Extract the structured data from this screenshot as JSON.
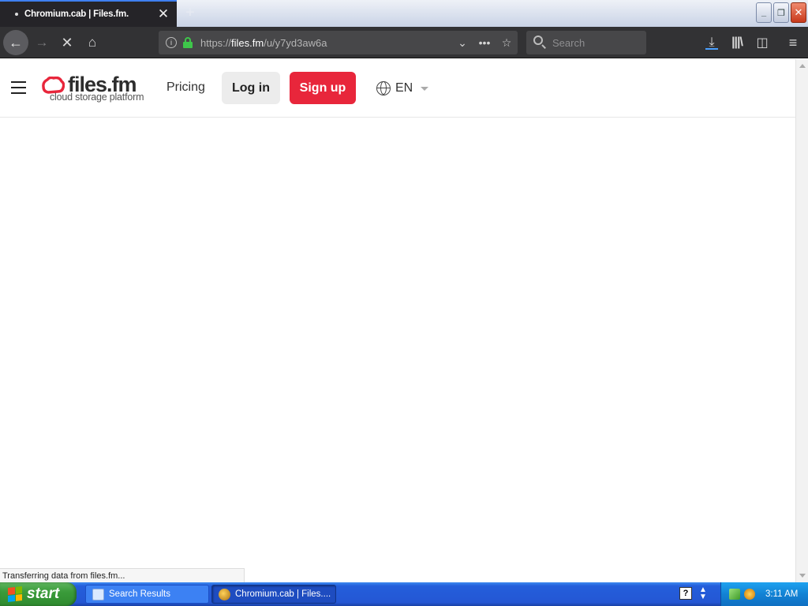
{
  "browser": {
    "tab": {
      "title": "Chromium.cab | Files.fm.",
      "close": "✕"
    },
    "new_tab": "+",
    "window_controls": {
      "minimize": "_",
      "restore": "❐",
      "close": "✕"
    },
    "nav": {
      "back": "←",
      "forward": "→",
      "stop": "✕",
      "home": "⌂"
    },
    "url": {
      "scheme": "https://",
      "host": "files.fm",
      "path": "/u/y7yd3aw6a"
    },
    "url_buttons": {
      "dropdown": "⌄",
      "page_actions": "•••",
      "bookmark": "☆"
    },
    "search": {
      "placeholder": "Search"
    },
    "toolbar": {
      "download": "⤓",
      "library": "|||\\",
      "sidebar": "◫",
      "menu": "≡"
    },
    "status_text": "Transferring data from files.fm..."
  },
  "site": {
    "logo": {
      "name": "files.fm",
      "tagline": "cloud storage platform",
      "color": "#e8263b"
    },
    "nav": {
      "pricing": "Pricing"
    },
    "buttons": {
      "login": "Log in",
      "signup": "Sign up"
    },
    "language": "EN"
  },
  "taskbar": {
    "start": "start",
    "windows": [
      {
        "label": "Search Results",
        "active": false
      },
      {
        "label": "Chromium.cab | Files....",
        "active": true
      }
    ],
    "quick_help": "?",
    "clock": "3:11 AM"
  },
  "colors": {
    "accent": "#e8263b",
    "chrome_dark": "#323234",
    "xp_blue": "#245edb",
    "xp_green": "#3a9b3a"
  }
}
